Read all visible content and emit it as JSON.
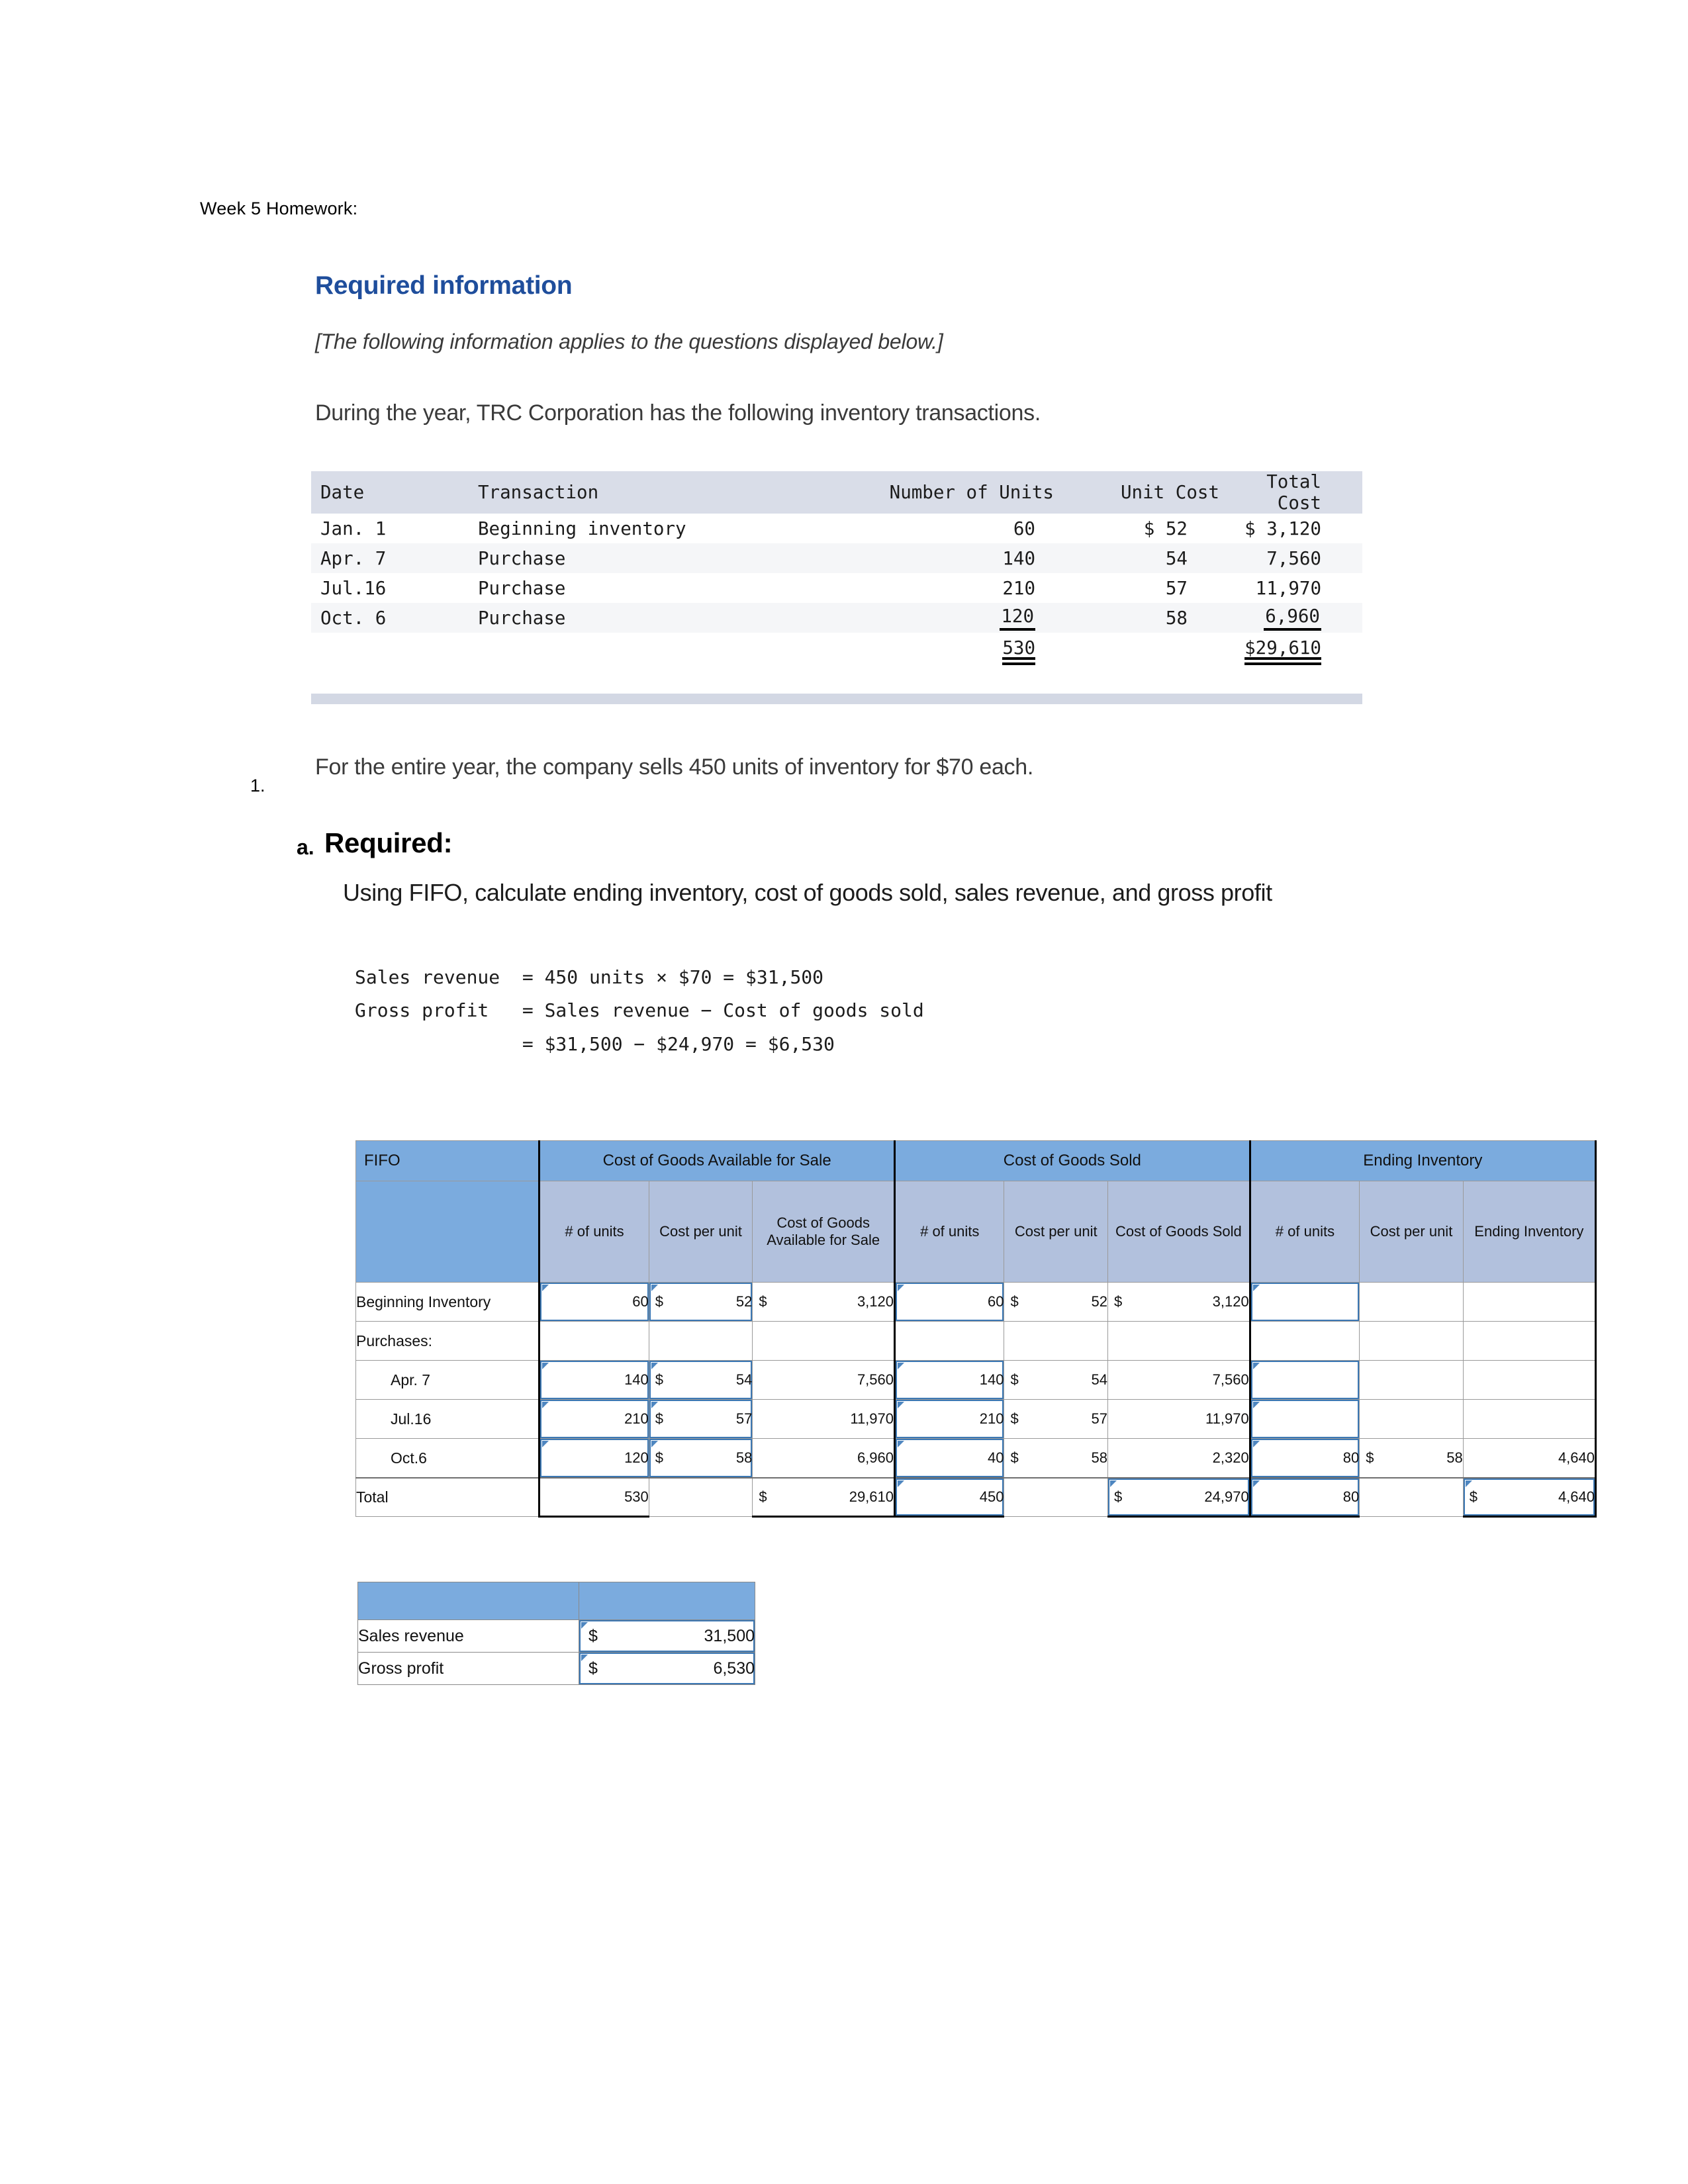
{
  "document": {
    "title": "Week 5 Homework:"
  },
  "required_information": {
    "heading": "Required information",
    "note": "[The following information applies to the questions displayed below.]",
    "intro": "During  the year, TRC Corporation has the following inventory transactions."
  },
  "inventory_table": {
    "columns": [
      "Date",
      "Transaction",
      "Number of Units",
      "Unit Cost",
      "Total Cost"
    ],
    "rows": [
      {
        "date": "Jan. 1",
        "transaction": "Beginning inventory",
        "units": "60",
        "unit_cost": "$ 52",
        "total_cost": "$ 3,120"
      },
      {
        "date": "Apr. 7",
        "transaction": "Purchase",
        "units": "140",
        "unit_cost": "54",
        "total_cost": "7,560"
      },
      {
        "date": "Jul.16",
        "transaction": "Purchase",
        "units": "210",
        "unit_cost": "57",
        "total_cost": "11,970"
      },
      {
        "date": "Oct. 6",
        "transaction": "Purchase",
        "units": "120",
        "unit_cost": "58",
        "total_cost": "6,960"
      }
    ],
    "totals": {
      "units": "530",
      "total_cost": "$29,610"
    }
  },
  "question": {
    "number": "1.",
    "sales_note": "For the entire year, the company sells 450 units of inventory for $70 each.",
    "sub_letter": "a.",
    "required_label": "Required:",
    "prompt": "Using FIFO, calculate ending inventory, cost of goods sold, sales revenue, and gross profit",
    "calculation": "Sales revenue  = 450 units × $70 = $31,500\nGross profit   = Sales revenue − Cost of goods sold\n               = $31,500 − $24,970 = $6,530"
  },
  "fifo_table": {
    "method_label": "FIFO",
    "group_headers": [
      "Cost of Goods Available for Sale",
      "Cost of Goods Sold",
      "Ending Inventory"
    ],
    "sub_headers": {
      "avail": [
        "# of units",
        "Cost per unit",
        "Cost of Goods Available for Sale"
      ],
      "cogs": [
        "# of units",
        "Cost per unit",
        "Cost of Goods Sold"
      ],
      "ending": [
        "# of units",
        "Cost per unit",
        "Ending Inventory"
      ]
    },
    "rows": [
      {
        "label": "Beginning Inventory",
        "indent": false,
        "avail_units": "60",
        "avail_cpu_sym": "$",
        "avail_cpu": "52",
        "avail_total_sym": "$",
        "avail_total": "3,120",
        "cogs_units": "60",
        "cogs_cpu_sym": "$",
        "cogs_cpu": "52",
        "cogs_total_sym": "$",
        "cogs_total": "3,120",
        "end_units": "",
        "end_cpu_sym": "",
        "end_cpu": "",
        "end_total_sym": "",
        "end_total": ""
      },
      {
        "label": "Purchases:",
        "indent": false,
        "avail_units": "",
        "avail_cpu_sym": "",
        "avail_cpu": "",
        "avail_total_sym": "",
        "avail_total": "",
        "cogs_units": "",
        "cogs_cpu_sym": "",
        "cogs_cpu": "",
        "cogs_total_sym": "",
        "cogs_total": "",
        "end_units": "",
        "end_cpu_sym": "",
        "end_cpu": "",
        "end_total_sym": "",
        "end_total": ""
      },
      {
        "label": "Apr. 7",
        "indent": true,
        "avail_units": "140",
        "avail_cpu_sym": "$",
        "avail_cpu": "54",
        "avail_total_sym": "",
        "avail_total": "7,560",
        "cogs_units": "140",
        "cogs_cpu_sym": "$",
        "cogs_cpu": "54",
        "cogs_total_sym": "",
        "cogs_total": "7,560",
        "end_units": "",
        "end_cpu_sym": "",
        "end_cpu": "",
        "end_total_sym": "",
        "end_total": ""
      },
      {
        "label": "Jul.16",
        "indent": true,
        "avail_units": "210",
        "avail_cpu_sym": "$",
        "avail_cpu": "57",
        "avail_total_sym": "",
        "avail_total": "11,970",
        "cogs_units": "210",
        "cogs_cpu_sym": "$",
        "cogs_cpu": "57",
        "cogs_total_sym": "",
        "cogs_total": "11,970",
        "end_units": "",
        "end_cpu_sym": "",
        "end_cpu": "",
        "end_total_sym": "",
        "end_total": ""
      },
      {
        "label": "Oct.6",
        "indent": true,
        "avail_units": "120",
        "avail_cpu_sym": "$",
        "avail_cpu": "58",
        "avail_total_sym": "",
        "avail_total": "6,960",
        "cogs_units": "40",
        "cogs_cpu_sym": "$",
        "cogs_cpu": "58",
        "cogs_total_sym": "",
        "cogs_total": "2,320",
        "end_units": "80",
        "end_cpu_sym": "$",
        "end_cpu": "58",
        "end_total_sym": "",
        "end_total": "4,640"
      }
    ],
    "total_row": {
      "label": "Total",
      "avail_units": "530",
      "avail_cpu": "",
      "avail_total_sym": "$",
      "avail_total": "29,610",
      "cogs_units": "450",
      "cogs_cpu": "",
      "cogs_total_sym": "$",
      "cogs_total": "24,970",
      "end_units": "80",
      "end_cpu": "",
      "end_total_sym": "$",
      "end_total": "4,640"
    }
  },
  "summary_table": {
    "rows": [
      {
        "label": "Sales revenue",
        "symbol": "$",
        "value": "31,500"
      },
      {
        "label": "Gross profit",
        "symbol": "$",
        "value": "6,530"
      }
    ]
  },
  "colors": {
    "heading_blue": "#1F4E9C",
    "table_header_blue": "#7BABDE",
    "table_subheader_blue": "#B2C1DD",
    "mono_header_gray": "#D9DDE8",
    "cell_outline_blue": "#3C78B4"
  }
}
